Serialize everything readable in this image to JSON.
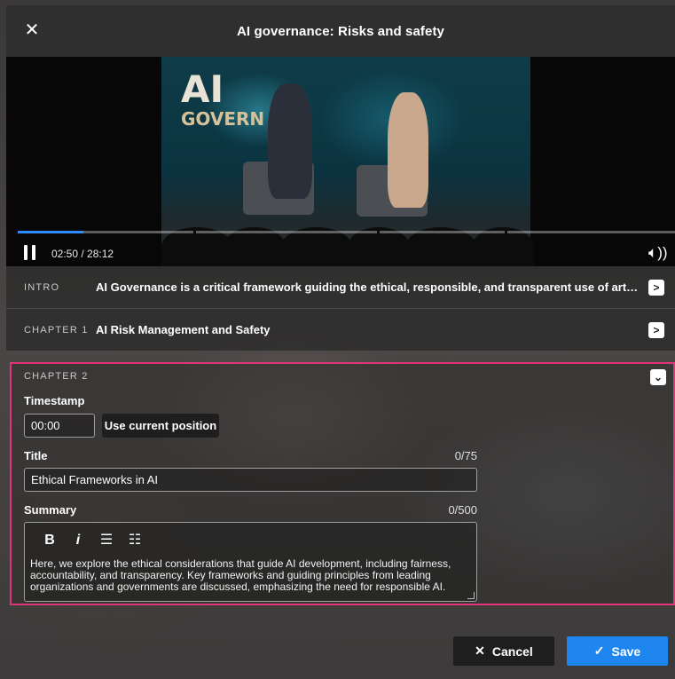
{
  "header": {
    "title": "AI governance: Risks and safety",
    "close_icon": "close-icon"
  },
  "video": {
    "sign_big": "AI",
    "sign_small": "GOVERN",
    "timecode": "02:50 / 28:12",
    "progress_fraction": 0.1,
    "play_icon": "pause-icon",
    "volume_icon": "volume-icon",
    "volume_glyph": "🔈︎))"
  },
  "chapters": [
    {
      "label": "INTRO",
      "title": "AI Governance is a critical framework guiding the ethical, responsible, and transparent use of artificial intelligence..."
    },
    {
      "label": "CHAPTER 1",
      "title": "AI Risk Management and Safety"
    }
  ],
  "edit": {
    "label": "CHAPTER 2",
    "timestamp_label": "Timestamp",
    "timestamp_value": "00:00",
    "use_current_label": "Use current position",
    "title_label": "Title",
    "title_counter": "0/75",
    "title_value": "Ethical Frameworks in AI",
    "summary_label": "Summary",
    "summary_counter": "0/500",
    "toolbar": {
      "bold": "B",
      "italic": "i",
      "bullet": "☰",
      "numbered": "☷"
    },
    "summary_text": "Here, we explore the ethical considerations that guide AI development, including fairness, accountability, and transparency. Key frameworks and guiding principles from leading organizations and governments are discussed, emphasizing the need for responsible AI."
  },
  "footer": {
    "cancel_label": "Cancel",
    "save_label": "Save"
  },
  "colors": {
    "accent": "#1f86f0",
    "highlight_border": "#e0357a"
  }
}
